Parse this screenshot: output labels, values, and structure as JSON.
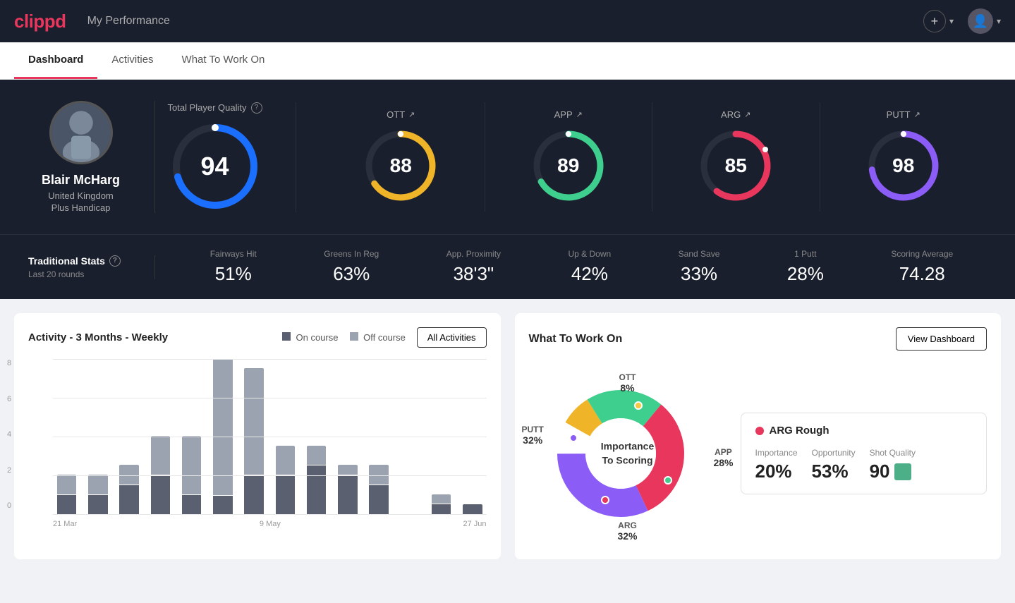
{
  "header": {
    "logo": "clippd",
    "title": "My Performance",
    "add_icon": "+",
    "chevron_down": "▾"
  },
  "nav": {
    "tabs": [
      {
        "label": "Dashboard",
        "active": true
      },
      {
        "label": "Activities",
        "active": false
      },
      {
        "label": "What To Work On",
        "active": false
      }
    ]
  },
  "player": {
    "name": "Blair McHarg",
    "country": "United Kingdom",
    "handicap": "Plus Handicap"
  },
  "total_quality": {
    "label": "Total Player Quality",
    "value": "94",
    "color_start": "#1a6fff",
    "color_end": "#1a6fff"
  },
  "quality_scores": [
    {
      "label": "OTT",
      "value": "88",
      "color": "#f0b429",
      "trend": "↗"
    },
    {
      "label": "APP",
      "value": "89",
      "color": "#3ecf8e",
      "trend": "↗"
    },
    {
      "label": "ARG",
      "value": "85",
      "color": "#e8365d",
      "trend": "↗"
    },
    {
      "label": "PUTT",
      "value": "98",
      "color": "#8b5cf6",
      "trend": "↗"
    }
  ],
  "trad_stats": {
    "title": "Traditional Stats",
    "subtitle": "Last 20 rounds",
    "items": [
      {
        "label": "Fairways Hit",
        "value": "51%"
      },
      {
        "label": "Greens In Reg",
        "value": "63%"
      },
      {
        "label": "App. Proximity",
        "value": "38'3\""
      },
      {
        "label": "Up & Down",
        "value": "42%"
      },
      {
        "label": "Sand Save",
        "value": "33%"
      },
      {
        "label": "1 Putt",
        "value": "28%"
      },
      {
        "label": "Scoring Average",
        "value": "74.28"
      }
    ]
  },
  "activity_chart": {
    "title": "Activity - 3 Months - Weekly",
    "legend_on": "On course",
    "legend_off": "Off course",
    "all_activities_btn": "All Activities",
    "y_labels": [
      "8",
      "6",
      "4",
      "2",
      "0"
    ],
    "x_labels": [
      "21 Mar",
      "9 May",
      "27 Jun"
    ],
    "bars": [
      {
        "on": 1,
        "off": 1
      },
      {
        "on": 1,
        "off": 1
      },
      {
        "on": 1.5,
        "off": 1
      },
      {
        "on": 2,
        "off": 2
      },
      {
        "on": 1,
        "off": 3
      },
      {
        "on": 1,
        "off": 7.5
      },
      {
        "on": 2,
        "off": 5.5
      },
      {
        "on": 2,
        "off": 1.5
      },
      {
        "on": 2.5,
        "off": 1
      },
      {
        "on": 2,
        "off": 0.5
      },
      {
        "on": 1.5,
        "off": 1
      },
      {
        "on": 0,
        "off": 0
      },
      {
        "on": 0.5,
        "off": 0.5
      },
      {
        "on": 0.5,
        "off": 0
      }
    ]
  },
  "what_to_work_on": {
    "title": "What To Work On",
    "view_dashboard_btn": "View Dashboard",
    "donut_center_line1": "Importance",
    "donut_center_line2": "To Scoring",
    "segments": [
      {
        "label": "OTT",
        "pct": "8%",
        "color": "#f0b429"
      },
      {
        "label": "APP",
        "pct": "28%",
        "color": "#3ecf8e"
      },
      {
        "label": "ARG",
        "pct": "32%",
        "color": "#e8365d"
      },
      {
        "label": "PUTT",
        "pct": "32%",
        "color": "#8b5cf6"
      }
    ],
    "card": {
      "title": "ARG Rough",
      "dot_color": "#e8365d",
      "metrics": [
        {
          "label": "Importance",
          "value": "20%"
        },
        {
          "label": "Opportunity",
          "value": "53%"
        },
        {
          "label": "Shot Quality",
          "value": "90"
        }
      ]
    }
  }
}
